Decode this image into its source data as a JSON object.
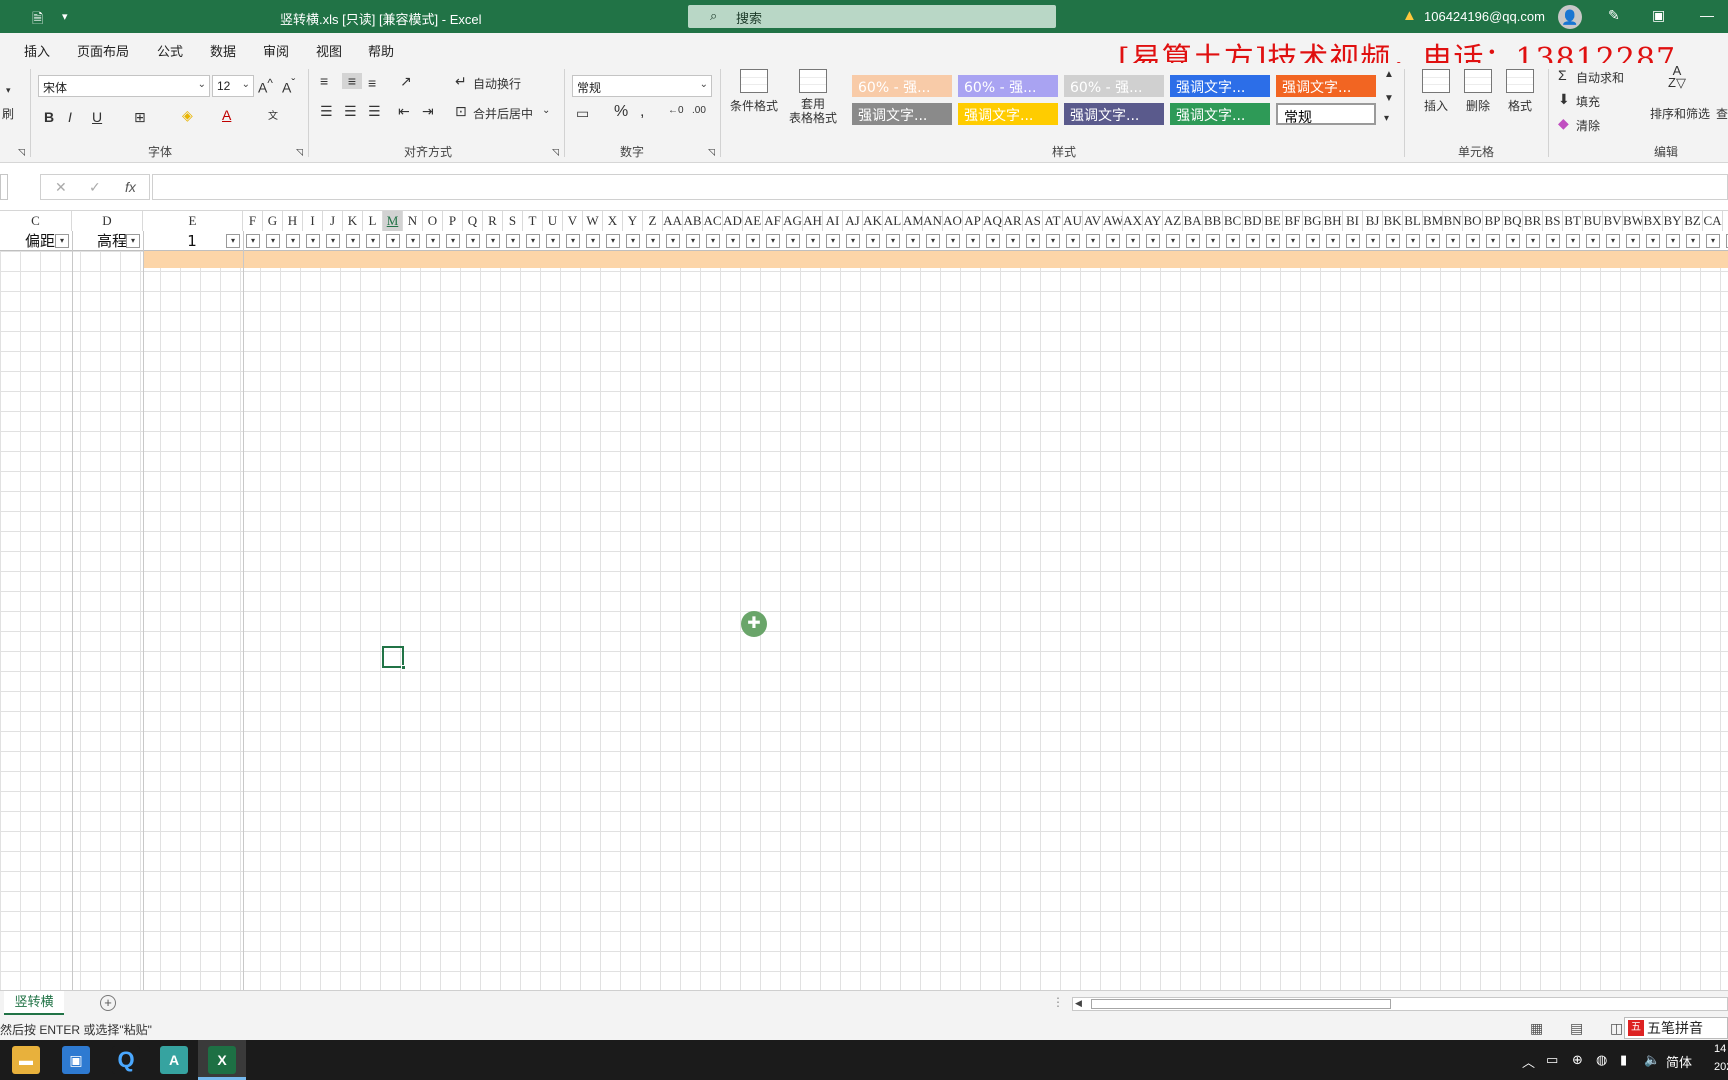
{
  "titlebar": {
    "autosave_icon": "file-save-icon",
    "customize_icon": "quick-access-dropdown-icon",
    "title": "竖转横.xls  [只读]  [兼容模式]  -  Excel",
    "search_placeholder": "搜索",
    "account": "106424196@qq.com",
    "warning_icon": "warning-icon"
  },
  "tabs": [
    "插入",
    "页面布局",
    "公式",
    "数据",
    "审阅",
    "视图",
    "帮助"
  ],
  "watermark": "[易算土方]技术视频，电话：13812287",
  "ribbon": {
    "clipboard_tail": "刷",
    "font_name": "宋体",
    "font_size": "12",
    "font_group": "字体",
    "wrap_text": "自动换行",
    "merge_center": "合并后居中",
    "align_group": "对齐方式",
    "number_format": "常规",
    "number_group": "数字",
    "cond_format": "条件格式",
    "table_format_1": "套用",
    "table_format_2": "表格格式",
    "styles_group": "样式",
    "insert": "插入",
    "delete": "删除",
    "format": "格式",
    "cells_group": "单元格",
    "autosum": "自动求和",
    "fill": "填充",
    "clear": "清除",
    "sort_filter": "排序和筛选",
    "find": "查",
    "edit_group": "编辑",
    "styles": [
      {
        "label": "60% - 强...",
        "bg": "#f8cba8",
        "fg": "#ffffff"
      },
      {
        "label": "60% - 强...",
        "bg": "#a9a3f2",
        "fg": "#ffffff"
      },
      {
        "label": "60% - 强...",
        "bg": "#d0d0d0",
        "fg": "#ffffff"
      },
      {
        "label": "强调文字...",
        "bg": "#2c6ee8",
        "fg": "#ffffff"
      },
      {
        "label": "强调文字...",
        "bg": "#f26522",
        "fg": "#ffffff"
      },
      {
        "label": "强调文字...",
        "bg": "#8a8a8a",
        "fg": "#ffffff"
      },
      {
        "label": "强调文字...",
        "bg": "#ffcc00",
        "fg": "#ffffff"
      },
      {
        "label": "强调文字...",
        "bg": "#5a5a8c",
        "fg": "#ffffff"
      },
      {
        "label": "强调文字...",
        "bg": "#2e9a57",
        "fg": "#ffffff"
      },
      {
        "label": "常规",
        "bg": "#ffffff",
        "fg": "#000000"
      }
    ]
  },
  "formula_bar": {
    "fx": "fx",
    "value": ""
  },
  "sheet": {
    "columns": [
      "C",
      "D",
      "E",
      "F",
      "G",
      "H",
      "I",
      "J",
      "K",
      "L",
      "M",
      "N",
      "O",
      "P",
      "Q",
      "R",
      "S",
      "T",
      "U",
      "V",
      "W",
      "X",
      "Y",
      "Z",
      "AA",
      "AB",
      "AC",
      "AD",
      "AE",
      "AF",
      "AG",
      "AH",
      "AI",
      "AJ",
      "AK",
      "AL",
      "AM",
      "AN",
      "AO",
      "AP",
      "AQ",
      "AR",
      "AS",
      "AT",
      "AU",
      "AV",
      "AW",
      "AX",
      "AY",
      "AZ",
      "BA",
      "BB",
      "BC",
      "BD",
      "BE",
      "BF",
      "BG",
      "BH",
      "BI",
      "BJ",
      "BK",
      "BL",
      "BM",
      "BN",
      "BO",
      "BP",
      "BQ",
      "BR",
      "BS",
      "BT",
      "BU",
      "BV",
      "BW",
      "BX",
      "BY",
      "BZ",
      "CA",
      "C"
    ],
    "active_column": "M",
    "header_c": "偏距",
    "header_d": "高程",
    "header_e": "1"
  },
  "sheet_tab": "竖转横",
  "status_message": "然后按 ENTER 或选择\"粘贴\"",
  "ime": "五笔拼音",
  "tray": {
    "lang": "简体",
    "time": "14",
    "date": "202"
  },
  "colors": {
    "excel_green": "#217346",
    "header_fill": "#fcd5a8",
    "watermark": "#e01010"
  }
}
